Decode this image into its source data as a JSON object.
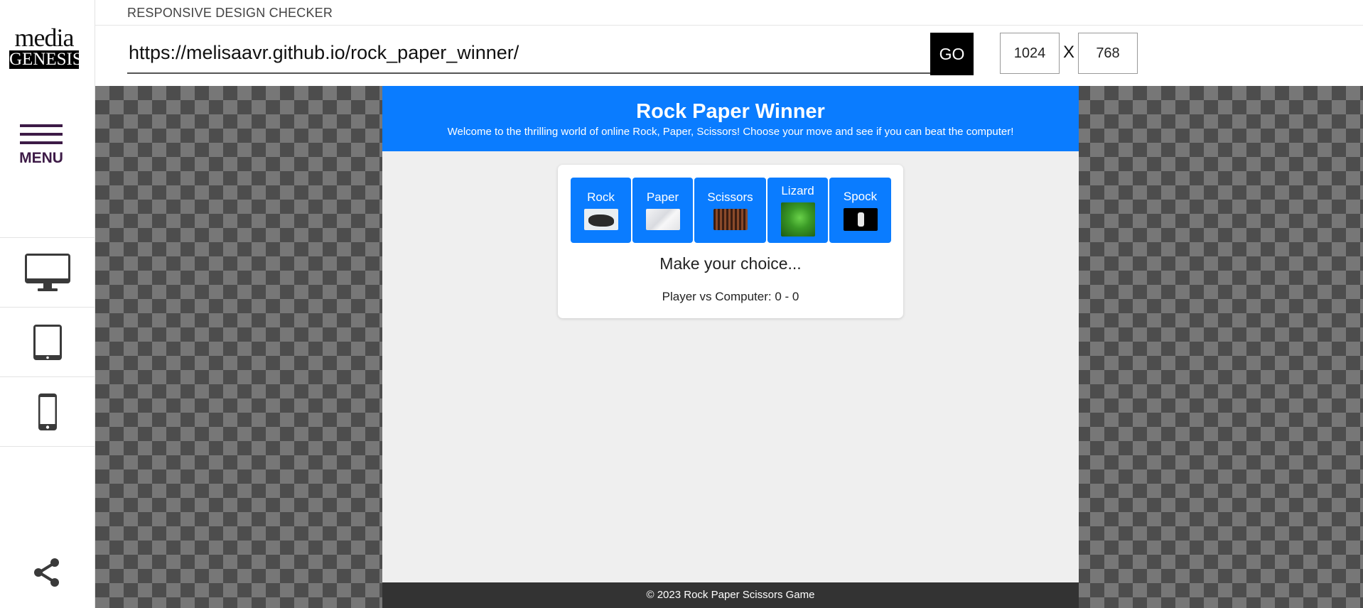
{
  "logo": {
    "top": "media",
    "bottom": "GENESIS"
  },
  "sidebar": {
    "menu_label": "MENU",
    "devices": [
      {
        "icon": "desktop-icon"
      },
      {
        "icon": "tablet-icon"
      },
      {
        "icon": "phone-icon"
      }
    ],
    "share_icon": "share-icon"
  },
  "topbar": {
    "title": "RESPONSIVE DESIGN CHECKER",
    "url": "https://melisaavr.github.io/rock_paper_winner/",
    "go_label": "GO",
    "width": "1024",
    "x_label": "X",
    "height": "768"
  },
  "site": {
    "title": "Rock Paper Winner",
    "subtitle": "Welcome to the thrilling world of online Rock, Paper, Scissors! Choose your move and see if you can beat the computer!",
    "choices": [
      {
        "label": "Rock"
      },
      {
        "label": "Paper"
      },
      {
        "label": "Scissors"
      },
      {
        "label": "Lizard"
      },
      {
        "label": "Spock"
      }
    ],
    "prompt": "Make your choice...",
    "score": "Player vs Computer: 0 - 0",
    "footer": "© 2023 Rock Paper Scissors Game"
  },
  "colors": {
    "accent": "#0a7cff",
    "menu": "#3d1b47",
    "footer_bg": "#333333"
  }
}
